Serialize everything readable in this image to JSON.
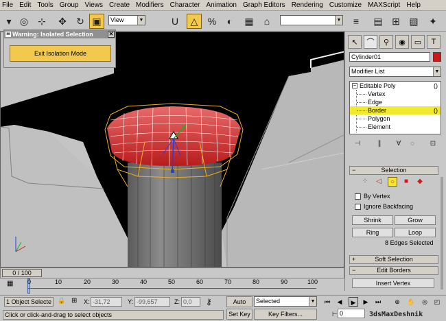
{
  "menu": [
    "File",
    "Edit",
    "Tools",
    "Group",
    "Views",
    "Create",
    "Modifiers",
    "Character",
    "Animation",
    "Graph Editors",
    "Rendering",
    "Customize",
    "MAXScript",
    "Help"
  ],
  "toolbar": {
    "view_select": "View",
    "icons": [
      "undo-icon",
      "select-icon",
      "select-region-icon",
      "move-icon",
      "rotate-icon",
      "scale-icon",
      "snap-icon",
      "angle-snap-icon",
      "percent-snap-icon",
      "spinner-snap-icon",
      "mirror-icon",
      "align-icon",
      "layers-icon",
      "curve-editor-icon",
      "schematic-icon",
      "material-editor-icon",
      "render-icon"
    ]
  },
  "isolation": {
    "title": "Warning: Isolated Selection",
    "close": "✕",
    "exit_button": "Exit Isolation Mode"
  },
  "panel": {
    "object_name": "Cylinder01",
    "object_color": "#cc1a1a",
    "modifier_list": "Modifier List",
    "stack": {
      "root": "Editable Poly",
      "items": [
        "Vertex",
        "Edge",
        "Border",
        "Polygon",
        "Element"
      ],
      "selected": "Border"
    },
    "selection": {
      "header": "Selection",
      "by_vertex": "By Vertex",
      "ignore_backfacing": "Ignore Backfacing",
      "shrink": "Shrink",
      "grow": "Grow",
      "ring": "Ring",
      "loop": "Loop",
      "status": "8 Edges Selected"
    },
    "soft_selection": "Soft Selection",
    "edit_borders": "Edit Borders",
    "insert_vertex": "Insert Vertex"
  },
  "timeline": {
    "slider": "0 / 100",
    "ticks": [
      "0",
      "10",
      "20",
      "30",
      "40",
      "50",
      "60",
      "70",
      "80",
      "90",
      "100"
    ]
  },
  "status": {
    "objects_selected": "1 Object Selecte",
    "x_label": "X:",
    "x_value": "-31,72",
    "y_label": "Y:",
    "y_value": "-99,657",
    "z_label": "Z:",
    "z_value": "0,0",
    "prompt": "Click or click-and-drag to select objects",
    "auto_key": "Auto Key",
    "set_key": "Set Key",
    "key_mode": "Selected",
    "key_filters": "Key Filters...",
    "frame": "0",
    "watermark": "3dsMaxDeshnik"
  },
  "colors": {
    "accent_yellow": "#f2c94c",
    "highlight": "#f2e830",
    "selection_red": "#cc1a1a"
  }
}
